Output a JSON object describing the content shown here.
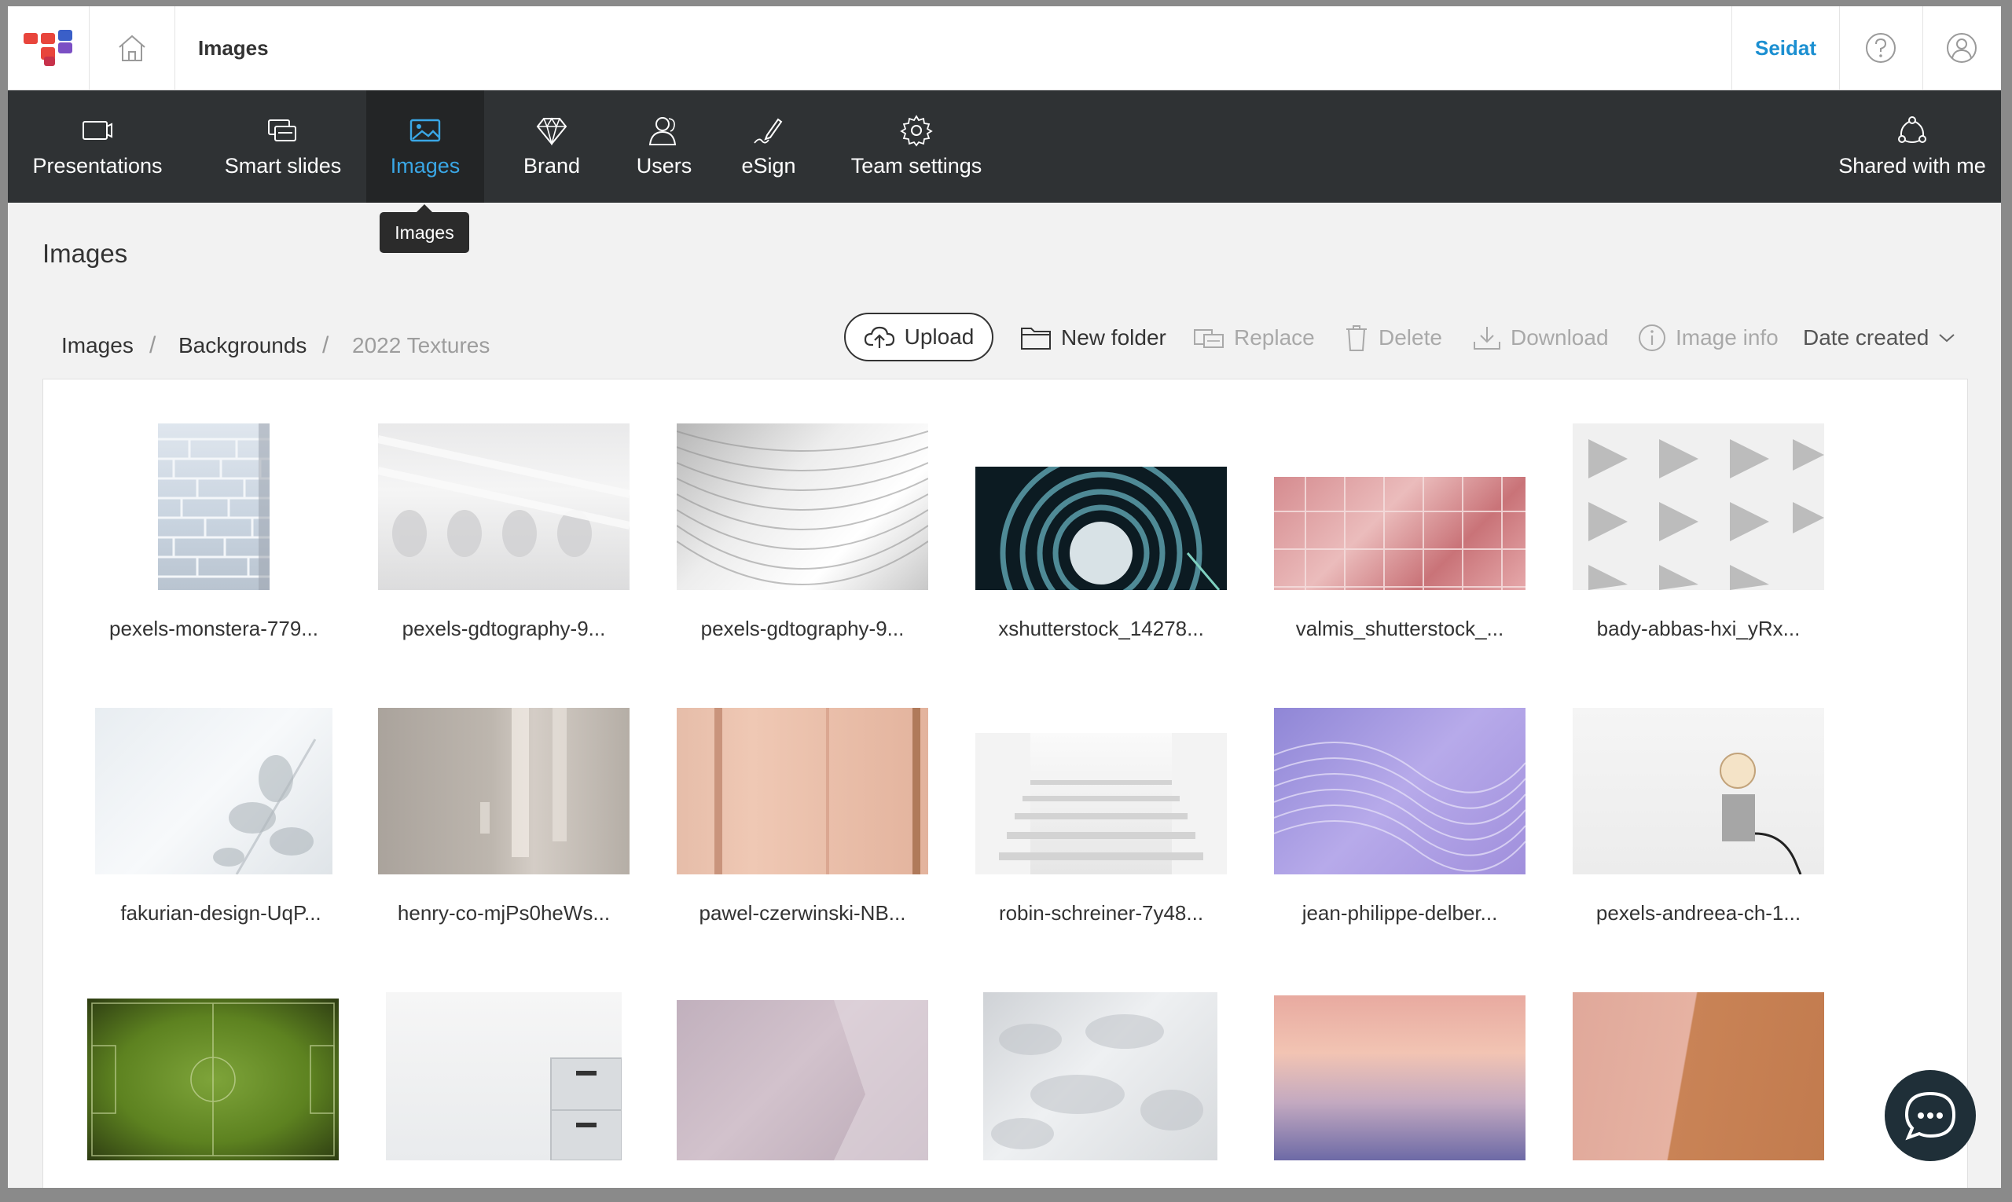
{
  "topbar": {
    "breadcrumb_title": "Images",
    "user_name": "Seidat"
  },
  "nav": {
    "items": [
      {
        "label": "Presentations",
        "icon": "presentation-icon"
      },
      {
        "label": "Smart slides",
        "icon": "smart-slides-icon"
      },
      {
        "label": "Images",
        "icon": "image-icon",
        "active": true
      },
      {
        "label": "Brand",
        "icon": "diamond-icon"
      },
      {
        "label": "Users",
        "icon": "users-icon"
      },
      {
        "label": "eSign",
        "icon": "pen-icon"
      },
      {
        "label": "Team settings",
        "icon": "gear-icon"
      }
    ],
    "shared_label": "Shared with me",
    "tooltip": "Images"
  },
  "page": {
    "title": "Images"
  },
  "breadcrumb": {
    "items": [
      "Images",
      "Backgrounds",
      "2022 Textures"
    ],
    "separator": "/"
  },
  "toolbar": {
    "upload": "Upload",
    "new_folder": "New folder",
    "replace": "Replace",
    "delete": "Delete",
    "download": "Download",
    "image_info": "Image info",
    "sort": "Date created"
  },
  "images": [
    {
      "name": "pexels-monstera-779..."
    },
    {
      "name": "pexels-gdtography-9..."
    },
    {
      "name": "pexels-gdtography-9..."
    },
    {
      "name": "xshutterstock_14278..."
    },
    {
      "name": "valmis_shutterstock_..."
    },
    {
      "name": "bady-abbas-hxi_yRx..."
    },
    {
      "name": "fakurian-design-UqP..."
    },
    {
      "name": "henry-co-mjPs0heWs..."
    },
    {
      "name": "pawel-czerwinski-NB..."
    },
    {
      "name": "robin-schreiner-7y48..."
    },
    {
      "name": "jean-philippe-delber..."
    },
    {
      "name": "pexels-andreea-ch-1..."
    }
  ],
  "colors": {
    "accent": "#1b8fd1",
    "nav_bg": "#2f3234",
    "active_nav": "#3aa7e6"
  }
}
